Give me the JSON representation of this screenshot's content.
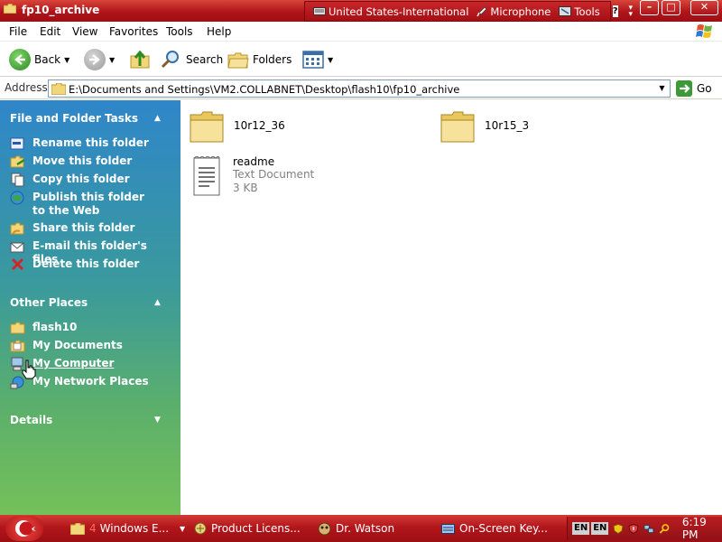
{
  "window": {
    "title": "fp10_archive",
    "buttons": [
      "minimize",
      "maximize",
      "close"
    ]
  },
  "language_bar": {
    "keyboard_label": "United States-International",
    "microphone_label": "Microphone",
    "tools_label": "Tools",
    "help_label": "?"
  },
  "menu": {
    "items": [
      "File",
      "Edit",
      "View",
      "Favorites",
      "Tools",
      "Help"
    ]
  },
  "toolbar": {
    "back_label": "Back",
    "search_label": "Search",
    "folders_label": "Folders"
  },
  "address": {
    "label": "Address",
    "path": "E:\\Documents and Settings\\VM2.COLLABNET\\Desktop\\flash10\\fp10_archive",
    "go_label": "Go"
  },
  "taskpane": {
    "file_tasks": {
      "title": "File and Folder Tasks",
      "items": [
        {
          "label": "Rename this folder",
          "icon": "rename-icon"
        },
        {
          "label": "Move this folder",
          "icon": "move-icon"
        },
        {
          "label": "Copy this folder",
          "icon": "copy-icon"
        },
        {
          "label": "Publish this folder to the Web",
          "icon": "publish-web-icon"
        },
        {
          "label": "Share this folder",
          "icon": "share-icon"
        },
        {
          "label": "E-mail this folder's files",
          "icon": "email-icon"
        },
        {
          "label": "Delete this folder",
          "icon": "delete-icon"
        }
      ]
    },
    "other_places": {
      "title": "Other Places",
      "items": [
        {
          "label": "flash10",
          "icon": "folder-icon"
        },
        {
          "label": "My Documents",
          "icon": "my-documents-icon"
        },
        {
          "label": "My Computer",
          "icon": "my-computer-icon"
        },
        {
          "label": "My Network Places",
          "icon": "network-places-icon"
        }
      ]
    },
    "details": {
      "title": "Details"
    }
  },
  "files": [
    {
      "name": "10r12_36",
      "type": "folder"
    },
    {
      "name": "10r15_3",
      "type": "folder"
    },
    {
      "name": "readme",
      "type": "document",
      "kind": "Text Document",
      "size": "3 KB"
    }
  ],
  "taskbar": {
    "tasks": [
      {
        "count": "4",
        "label": "Windows E...",
        "icon": "folder-icon"
      },
      {
        "label": "Product Licens...",
        "icon": "product-license-icon"
      },
      {
        "label": "Dr. Watson",
        "icon": "dr-watson-icon"
      },
      {
        "label": "On-Screen Key...",
        "icon": "keyboard-icon"
      }
    ],
    "tray": {
      "lang1": "EN",
      "lang2": "EN",
      "clock": "6:19 PM"
    }
  },
  "colors": {
    "title_red": "#b0141a",
    "pane_blue": "#2f86c9",
    "pane_green": "#74c05a",
    "folder_yellow": "#f2d67a"
  }
}
